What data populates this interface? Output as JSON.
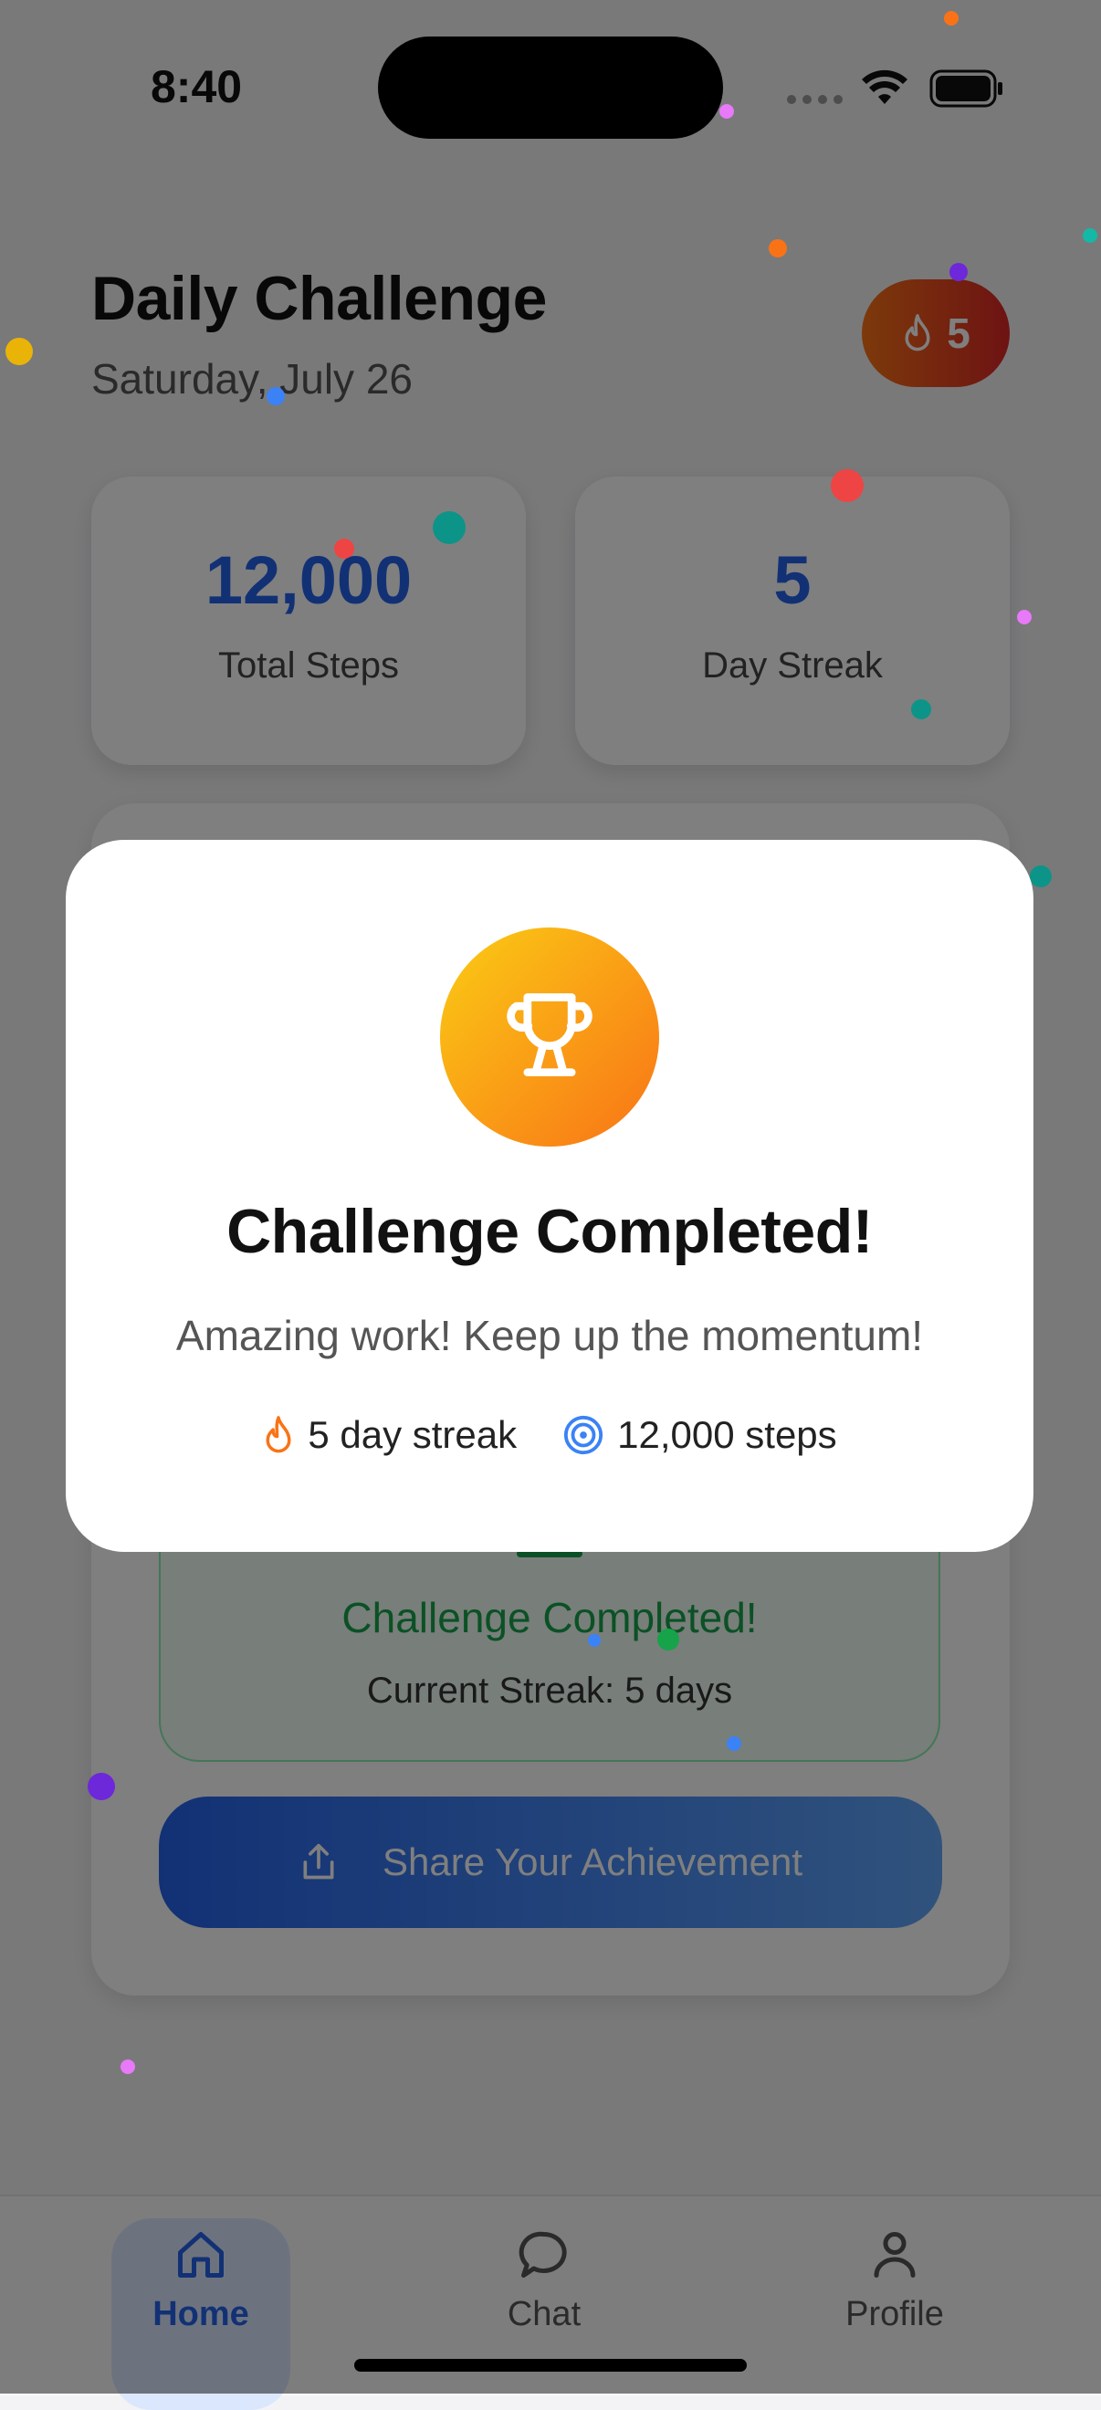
{
  "status_bar": {
    "time": "8:40"
  },
  "header": {
    "title": "Daily Challenge",
    "date": "Saturday, July 26",
    "streak_badge": "5"
  },
  "stats": [
    {
      "value": "12,000",
      "label": "Total Steps"
    },
    {
      "value": "5",
      "label": "Day Streak"
    }
  ],
  "challenge_card": {
    "title": "Challenge Completed!",
    "subtitle": "Current Streak: 5 days",
    "share_label": "Share Your Achievement"
  },
  "modal": {
    "title": "Challenge Completed!",
    "subtitle": "Amazing work! Keep up the momentum!",
    "streak_text": "5 day streak",
    "steps_text": "12,000 steps"
  },
  "nav": {
    "items": [
      {
        "label": "Home",
        "icon": "home-icon",
        "active": true
      },
      {
        "label": "Chat",
        "icon": "chat-icon",
        "active": false
      },
      {
        "label": "Profile",
        "icon": "profile-icon",
        "active": false
      }
    ]
  },
  "colors": {
    "accent": "#2563eb",
    "success": "#16a34a",
    "streak_gradient_start": "#f97316",
    "streak_gradient_end": "#dc2626",
    "trophy_gradient_start": "#facc15",
    "trophy_gradient_end": "#f97316"
  }
}
